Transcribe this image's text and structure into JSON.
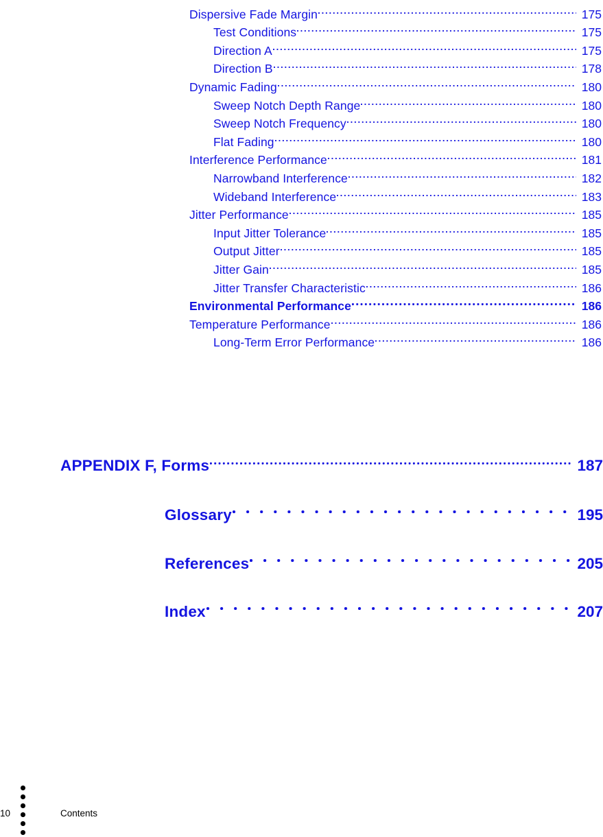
{
  "document": {
    "section_name": "Contents",
    "page_number": "10",
    "text_color": "#1414e0",
    "footer_color": "#000000",
    "footer_dot_count": 6
  },
  "toc_entries": [
    {
      "title": "Dispersive Fade Margin",
      "page": "175",
      "level": 1,
      "bold": false,
      "leader": "fine"
    },
    {
      "title": "Test Conditions",
      "page": "175",
      "level": 2,
      "bold": false,
      "leader": "fine"
    },
    {
      "title": "Direction A",
      "page": "175",
      "level": 2,
      "bold": false,
      "leader": "fine"
    },
    {
      "title": "Direction B",
      "page": "178",
      "level": 2,
      "bold": false,
      "leader": "fine"
    },
    {
      "title": "Dynamic Fading",
      "page": "180",
      "level": 1,
      "bold": false,
      "leader": "fine"
    },
    {
      "title": "Sweep Notch Depth Range",
      "page": "180",
      "level": 2,
      "bold": false,
      "leader": "fine"
    },
    {
      "title": "Sweep Notch Frequency",
      "page": "180",
      "level": 2,
      "bold": false,
      "leader": "fine"
    },
    {
      "title": "Flat Fading",
      "page": "180",
      "level": 2,
      "bold": false,
      "leader": "fine"
    },
    {
      "title": "Interference Performance",
      "page": "181",
      "level": 1,
      "bold": false,
      "leader": "fine"
    },
    {
      "title": "Narrowband Interference",
      "page": "182",
      "level": 2,
      "bold": false,
      "leader": "fine"
    },
    {
      "title": "Wideband Interference",
      "page": "183",
      "level": 2,
      "bold": false,
      "leader": "fine"
    },
    {
      "title": "Jitter Performance",
      "page": "185",
      "level": 1,
      "bold": false,
      "leader": "fine"
    },
    {
      "title": "Input Jitter Tolerance",
      "page": "185",
      "level": 2,
      "bold": false,
      "leader": "fine"
    },
    {
      "title": "Output Jitter",
      "page": "185",
      "level": 2,
      "bold": false,
      "leader": "fine"
    },
    {
      "title": "Jitter Gain",
      "page": "185",
      "level": 2,
      "bold": false,
      "leader": "fine"
    },
    {
      "title": "Jitter Transfer Characteristic",
      "page": "186",
      "level": 2,
      "bold": false,
      "leader": "fine"
    },
    {
      "title": "Environmental Performance",
      "page": "186",
      "level": 1,
      "bold": true,
      "leader": "fine-bold"
    },
    {
      "title": "Temperature Performance",
      "page": "186",
      "level": 1,
      "bold": false,
      "leader": "fine"
    },
    {
      "title": "Long-Term Error Performance",
      "page": "186",
      "level": 2,
      "bold": false,
      "leader": "fine"
    }
  ],
  "major_entries": [
    {
      "title": "APPENDIX F, Forms",
      "page": "187",
      "leader": "fine-bold"
    },
    {
      "title": "Glossary",
      "page": "195",
      "leader": "wide"
    },
    {
      "title": "References",
      "page": "205",
      "leader": "wide"
    },
    {
      "title": "Index",
      "page": "207",
      "leader": "wide"
    }
  ]
}
